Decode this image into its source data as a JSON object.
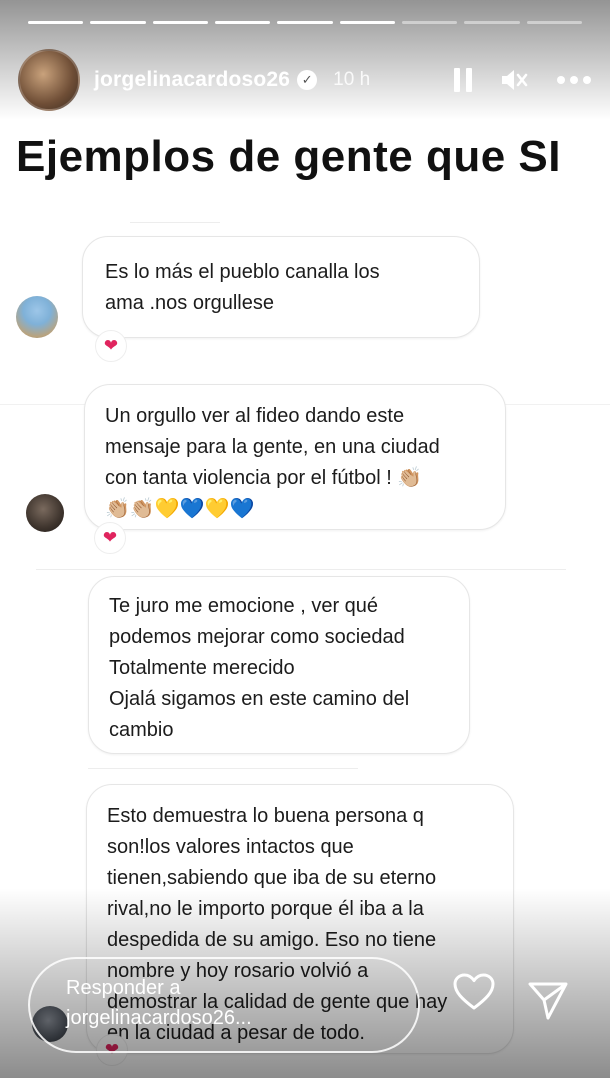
{
  "story": {
    "segments": 9,
    "active_segment": 6,
    "username": "jorgelinacardoso26",
    "verified_icon": "verified-badge-icon",
    "time": "10 h",
    "icons": [
      "pause-icon",
      "mute-icon",
      "more-icon"
    ]
  },
  "headline": "Ejemplos de gente que SI",
  "comments": [
    {
      "text": "Es lo más el pueblo canalla los\nama .nos orgullese",
      "reaction": "❤"
    },
    {
      "text": "Un orgullo ver al fideo dando este\nmensaje para la gente, en una ciudad\ncon tanta violencia por el fútbol ! 👏🏼\n👏🏼👏🏼💛💙💛💙",
      "reaction": "❤"
    },
    {
      "text": "Te juro me emocione , ver qué\npodemos mejorar como sociedad\nTotalmente merecido\nOjalá sigamos en este camino del\ncambio"
    },
    {
      "text": "Esto demuestra lo buena persona q\nson!los valores intactos que\ntienen,sabiendo que iba de su eterno\nrival,no le importo porque él iba a la\ndespedida de su amigo. Eso no tiene\nnombre y hoy rosario volvió a\ndemostrar la calidad de gente que hay\nen la ciudad a pesar de todo.",
      "reaction": "❤"
    }
  ],
  "reply": {
    "placeholder_line1": "Responder a",
    "placeholder_line2": "jorgelinacardoso26..."
  },
  "actions": [
    "like-heart-icon",
    "send-icon"
  ]
}
